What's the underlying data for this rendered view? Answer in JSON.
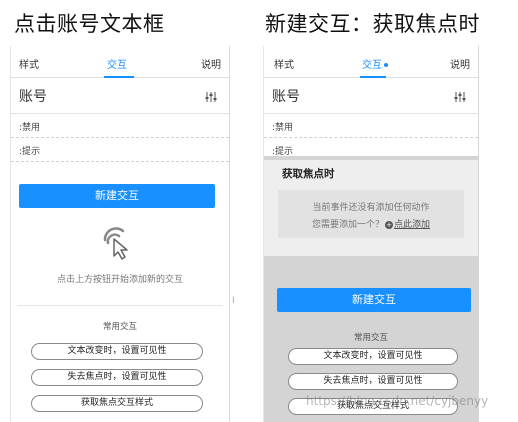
{
  "captions": {
    "left": "点击账号文本框",
    "right": "新建交互：获取焦点时"
  },
  "left_panel": {
    "tabs": [
      "样式",
      "交互",
      "说明"
    ],
    "widget_name": "账号",
    "fields": [
      ":禁用",
      ":提示"
    ],
    "new_interaction_label": "新建交互",
    "empty_hint": "点击上方按钮开始添加新的交互",
    "common_title": "常用交互",
    "common_actions": [
      "文本改变时，设置可见性",
      "失去焦点时，设置可见性",
      "获取焦点交互样式"
    ],
    "cursor_icon": "cursor-click-icon"
  },
  "right_panel": {
    "tabs": [
      "样式",
      "交互",
      "说明"
    ],
    "widget_name": "账号",
    "fields": [
      ":禁用",
      ":提示"
    ],
    "event_title": "获取焦点时",
    "event_empty_line1": "当前事件还没有添加任何动作",
    "event_empty_prefix": "您需要添加一个？",
    "event_add_link": "点此添加",
    "new_interaction_label": "新建交互",
    "common_title": "常用交互",
    "common_actions": [
      "文本改变时，设置可见性",
      "失去焦点时，设置可见性",
      "获取焦点交互样式"
    ]
  },
  "watermark": "https://blog.csdn.net/cyjbenyy",
  "colors": {
    "accent": "#1890ff",
    "modal_overlay": "#d4d4d4",
    "event_card": "#eeeeee"
  }
}
